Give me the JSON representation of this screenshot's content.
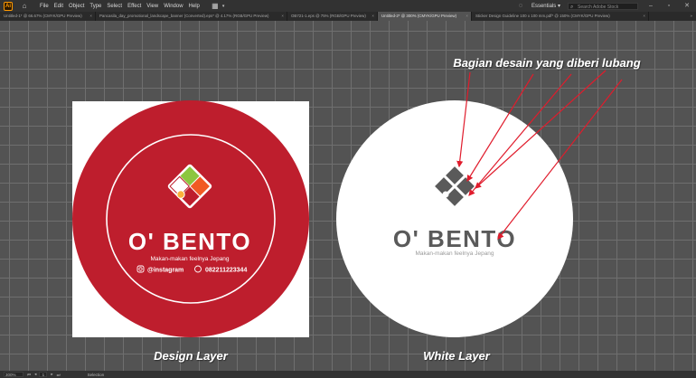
{
  "app": {
    "logo": "Ai",
    "menu": [
      "File",
      "Edit",
      "Object",
      "Type",
      "Select",
      "Effect",
      "View",
      "Window",
      "Help"
    ],
    "workspace": "Essentials",
    "search_placeholder": "Search Adobe Stock"
  },
  "tabs": [
    {
      "label": "Untitled-1* @ 66.67% (CMYK/GPU Preview)",
      "active": false
    },
    {
      "label": "Pancasila_day_promotional_landscape_banner (Converted).eps* @ 4.17% (RGB/GPU Preview)",
      "active": false
    },
    {
      "label": "OB721-1.eps @ 75% (RGB/GPU Preview)",
      "active": false
    },
    {
      "label": "Untitled-2* @ 300% (CMYK/GPU Preview)",
      "active": true
    },
    {
      "label": "Sticker Design Guideline 100 x 100 mm.pdf* @ 150% (CMYK/GPU Preview)",
      "active": false
    }
  ],
  "artwork": {
    "annotation": "Bagian desain yang diberi lubang",
    "brand_name": "O' BENTO",
    "tagline": "Makan-makan feelnya Jepang",
    "instagram_handle": "@instagram",
    "phone": "082211223344",
    "design_layer_label": "Design Layer",
    "white_layer_label": "White Layer",
    "colors": {
      "design_red": "#be1e2d",
      "white": "#ffffff",
      "logo_gray": "#5a5a5a",
      "leaf_green": "#8cc63f",
      "orange": "#f15a24",
      "egg_yolk": "#fbb03b",
      "arrow_red": "#e01c2c"
    }
  },
  "status": {
    "zoom": "300%",
    "page": "1",
    "mode": "Selection"
  }
}
